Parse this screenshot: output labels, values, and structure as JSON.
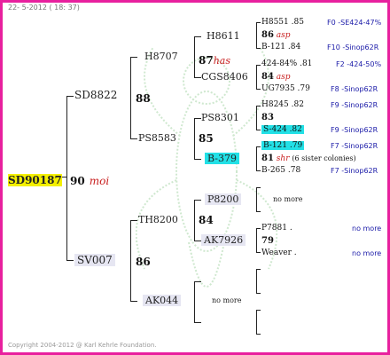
{
  "header": {
    "date": "22- 5-2012 ( 18: 37)"
  },
  "footer": {
    "copyright": "Copyright 2004-2012 @ Karl Kehrle Foundation."
  },
  "root": {
    "name": "SD90187",
    "num": "90",
    "label": "moi"
  },
  "gen1": [
    {
      "id": "sd8822",
      "name": "SD8822",
      "num": "88"
    },
    {
      "id": "sv007",
      "name": "SV007",
      "num": "86"
    }
  ],
  "gen2": [
    {
      "id": "h8707",
      "name": "H8707",
      "num": "87",
      "label": "has"
    },
    {
      "id": "ps8583",
      "name": "PS8583",
      "num": "85"
    },
    {
      "id": "th8200",
      "name": "TH8200",
      "num": "84"
    },
    {
      "id": "ak044",
      "name": "AK044",
      "nomore": "no more"
    }
  ],
  "gen3": [
    {
      "id": "h8611",
      "name": "H8611",
      "num": "86",
      "label": "asp"
    },
    {
      "id": "cgs8406",
      "name": "CGS8406",
      "num": "84",
      "label": "asp"
    },
    {
      "id": "ps8301",
      "name": "PS8301",
      "num": "83"
    },
    {
      "id": "b379",
      "name": "B-379",
      "num": "81",
      "label": "shr",
      "note": "(6 sister colonies)"
    },
    {
      "id": "p8200",
      "name": "P8200",
      "nomore": "no more"
    },
    {
      "id": "ak7926",
      "name": "AK7926",
      "num": "79"
    }
  ],
  "gen4": [
    {
      "id": "h8551",
      "name": "H8551 .85",
      "right": "F0 -SE424-47%"
    },
    {
      "id": "b121a",
      "name": "B-121 .84",
      "right": "F10 -Sinop62R"
    },
    {
      "id": "s424",
      "name": "424-84% .81",
      "right": "F2 -424-50%"
    },
    {
      "id": "ug7935",
      "name": "UG7935 .79",
      "right": "F8 -Sinop62R"
    },
    {
      "id": "h8245",
      "name": "H8245 .82",
      "right": "F9 -Sinop62R"
    },
    {
      "id": "s424b",
      "name": "S-424 .82",
      "right": "F9 -Sinop62R"
    },
    {
      "id": "b121b",
      "name": "B-121 .79",
      "right": "F7 -Sinop62R"
    },
    {
      "id": "b265",
      "name": "B-265 .78",
      "right": "F7 -Sinop62R"
    },
    {
      "id": "p7881",
      "name": "P7881 .",
      "right": "no more"
    },
    {
      "id": "weaver",
      "name": "Weaver .",
      "right": "no more"
    }
  ],
  "p8200_nomore": "no more",
  "colors": {
    "frame": "#e8209e",
    "highlight_cyan": "#22e0e6",
    "highlight_yellow": "#f4f000",
    "label_red": "#c81e1e",
    "link_blue": "#1a1aa8"
  }
}
